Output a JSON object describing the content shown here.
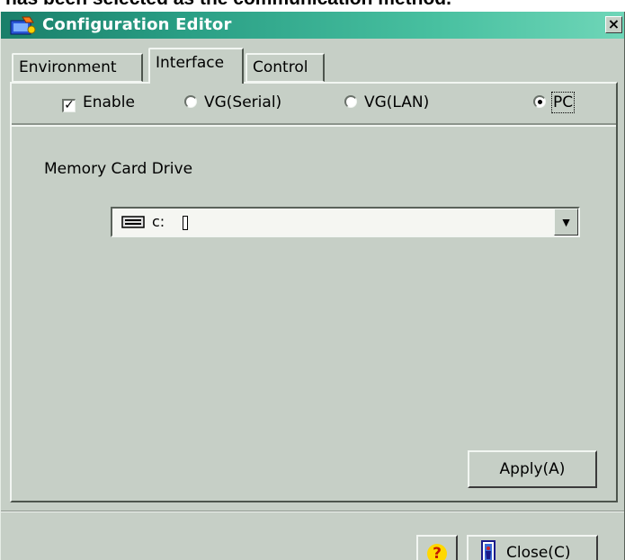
{
  "page": {
    "caption": "has been selected as the communication method."
  },
  "window": {
    "title": "Configuration Editor",
    "close_glyph": "×",
    "icon": "app-icon"
  },
  "tabs": [
    {
      "label": "Environment",
      "selected": false
    },
    {
      "label": "Interface",
      "selected": true
    },
    {
      "label": "Control",
      "selected": false
    }
  ],
  "options": {
    "enable_label": "Enable",
    "enable_checked": true,
    "radios": [
      {
        "label": "VG(Serial)",
        "selected": false
      },
      {
        "label": "VG(LAN)",
        "selected": false
      },
      {
        "label": "PC",
        "selected": true
      }
    ]
  },
  "memory_card": {
    "label": "Memory Card Drive",
    "drive_value": "c:",
    "drive_icon": "drive-icon"
  },
  "buttons": {
    "apply_label": "Apply(A)",
    "help_glyph": "?",
    "close_label": "Close(C)"
  },
  "colors": {
    "titlebar_start": "#1a7f6a",
    "titlebar_end": "#6fd6b8",
    "window_bg": "#c6cfc6",
    "field_bg": "#f5f6f2"
  }
}
